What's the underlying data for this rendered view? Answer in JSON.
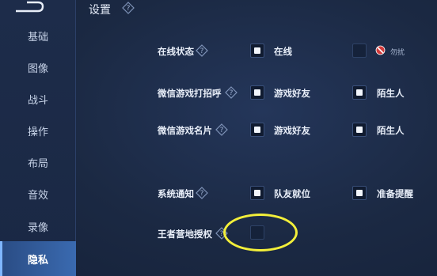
{
  "header": {
    "title": "设置"
  },
  "sidebar": {
    "items": [
      {
        "label": "基础"
      },
      {
        "label": "图像"
      },
      {
        "label": "战斗"
      },
      {
        "label": "操作"
      },
      {
        "label": "布局"
      },
      {
        "label": "音效"
      },
      {
        "label": "录像"
      },
      {
        "label": "隐私",
        "active": true
      }
    ]
  },
  "rows": [
    {
      "label": "在线状态",
      "options": [
        {
          "label": "在线",
          "checked": true
        },
        {
          "label": "勿扰",
          "checked": false,
          "icon": "no-entry-icon"
        }
      ]
    },
    {
      "label": "微信游戏打招呼",
      "options": [
        {
          "label": "游戏好友",
          "checked": true
        },
        {
          "label": "陌生人",
          "checked": true
        }
      ]
    },
    {
      "label": "微信游戏名片",
      "options": [
        {
          "label": "游戏好友",
          "checked": true
        },
        {
          "label": "陌生人",
          "checked": true
        }
      ]
    },
    {
      "label": "系统通知",
      "options": [
        {
          "label": "队友就位",
          "checked": true
        },
        {
          "label": "准备提醒",
          "checked": true
        }
      ]
    },
    {
      "label": "王者营地授权",
      "options": [
        {
          "label": "",
          "checked": false
        }
      ]
    }
  ],
  "annotation": {
    "color": "#f3ef3a"
  },
  "colors": {
    "accent": "#3a6ab0",
    "background": "#1c2a44"
  }
}
